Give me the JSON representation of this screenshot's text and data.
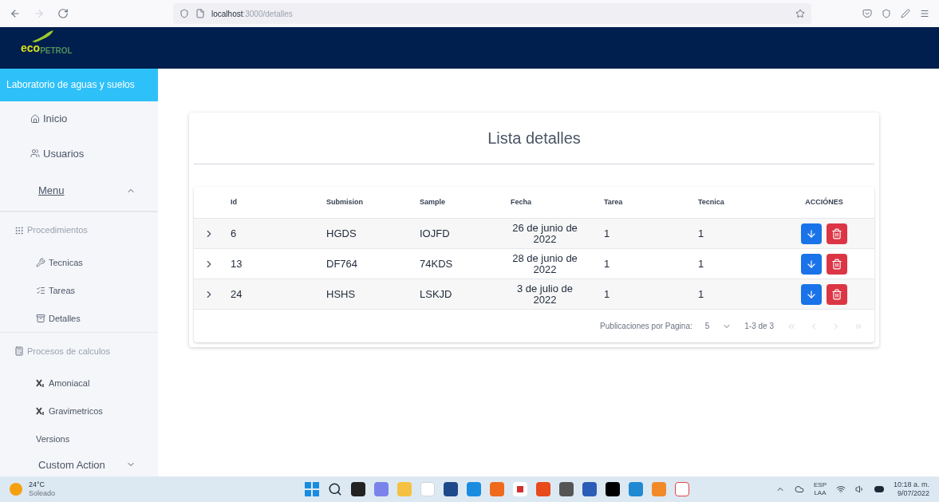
{
  "browser": {
    "url_host": "localhost",
    "url_path": ":3000/detalles"
  },
  "logo": {
    "part_1": "eco",
    "part_2": "PETROL"
  },
  "sidebar": {
    "title": "Laboratorio de aguas y suelos",
    "items": [
      {
        "kind": "nav",
        "label": "Inicio"
      },
      {
        "kind": "nav",
        "label": "Usuarios"
      },
      {
        "kind": "menu",
        "label": "Menu",
        "expanded": true
      },
      {
        "kind": "section",
        "label": "Procedimientos"
      },
      {
        "kind": "sub",
        "label": "Tecnicas"
      },
      {
        "kind": "sub",
        "label": "Tareas"
      },
      {
        "kind": "sub",
        "label": "Detalles"
      },
      {
        "kind": "section",
        "label": "Procesos de calculos"
      },
      {
        "kind": "sub",
        "label": "Amoniacal"
      },
      {
        "kind": "sub",
        "label": "Gravimetricos"
      },
      {
        "kind": "sub",
        "label": "Versions"
      },
      {
        "kind": "menu",
        "label": "Custom Action",
        "expanded": false
      }
    ]
  },
  "card": {
    "title": "Lista detalles",
    "table": {
      "columns": [
        "Id",
        "Submision",
        "Sample",
        "Fecha",
        "Tarea",
        "Tecnica",
        "ACCIÓNES"
      ],
      "rows": [
        {
          "expanded": false,
          "cells": [
            "6",
            "HGDS",
            "IOJFD",
            "26 de junio de 2022",
            "1",
            "1"
          ]
        },
        {
          "expanded": false,
          "cells": [
            "13",
            "DF764",
            "74KDS",
            "28 de junio de 2022",
            "1",
            "1"
          ]
        },
        {
          "expanded": false,
          "cells": [
            "24",
            "HSHS",
            "LSKJD",
            "3 de julio de 2022",
            "1",
            "1"
          ]
        }
      ]
    },
    "pagination": {
      "label": "Publicaciones por Pagina:",
      "per_page": "5",
      "range": "1-3 de 3"
    }
  },
  "taskbar": {
    "temperature": "24°C",
    "weather": "Soleado",
    "language": "ESP",
    "layout": "LAA",
    "time": "10:18 a. m.",
    "date": "9/07/2022"
  }
}
